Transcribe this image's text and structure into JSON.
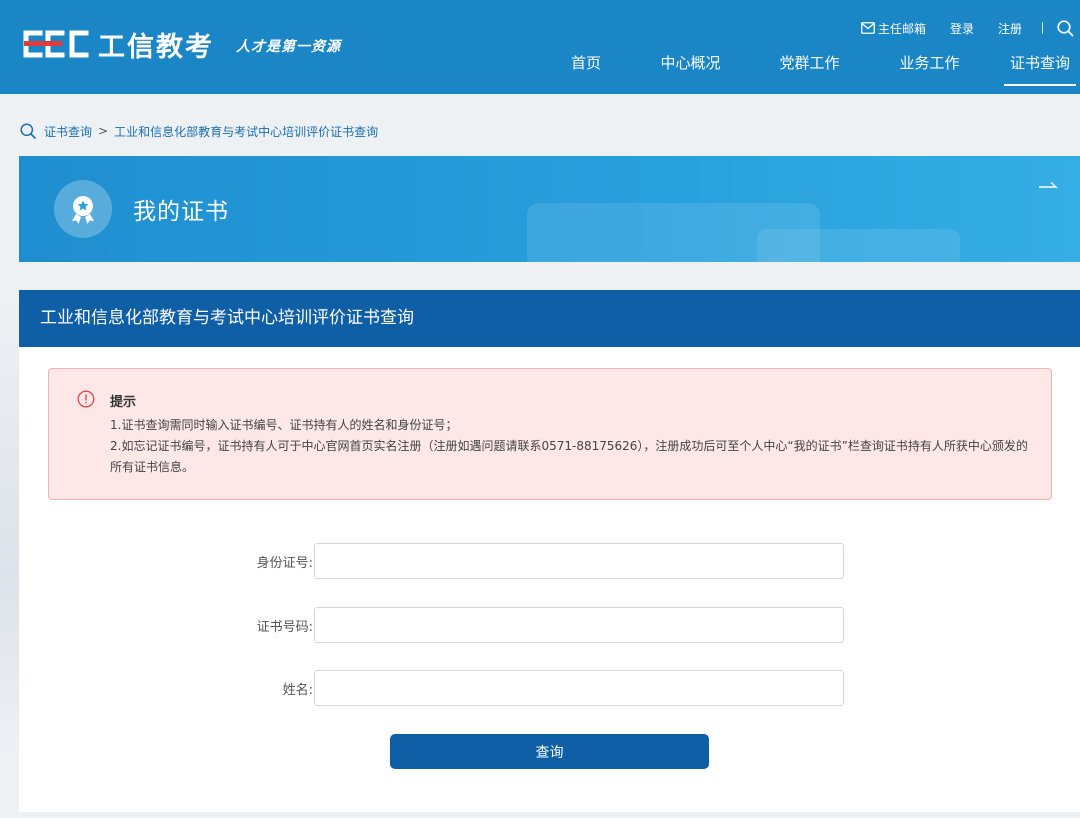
{
  "header": {
    "logo_text": "工信教考",
    "slogan": "人才是第一资源",
    "top_links": {
      "mailbox": "主任邮箱",
      "login": "登录",
      "register": "注册"
    },
    "nav": [
      {
        "label": "首页"
      },
      {
        "label": "中心概况"
      },
      {
        "label": "党群工作"
      },
      {
        "label": "业务工作"
      },
      {
        "label": "证书查询",
        "active": true
      }
    ]
  },
  "breadcrumb": {
    "items": [
      "证书查询",
      "工业和信息化部教育与考试中心培训评价证书查询"
    ],
    "separator": ">"
  },
  "banner": {
    "title": "我的证书"
  },
  "panel": {
    "title": "工业和信息化部教育与考试中心培训评价证书查询",
    "notice": {
      "title": "提示",
      "lines": [
        "1.证书查询需同时输入证书编号、证书持有人的姓名和身份证号；",
        "2.如忘记证书编号，证书持有人可于中心官网首页实名注册（注册如遇问题请联系0571-88175626），注册成功后可至个人中心“我的证书”栏查询证书持有人所获中心颁发的所有证书信息。"
      ]
    },
    "form": {
      "id_label": "身份证号:",
      "id_value": "",
      "cert_label": "证书号码:",
      "cert_value": "",
      "name_label": "姓名:",
      "name_value": "",
      "submit_label": "查询"
    }
  },
  "colors": {
    "header_bg": "#1a86c6",
    "panel_head_bg": "#0f5fa6",
    "notice_bg": "#fde7e7",
    "notice_border": "#f3b2b2",
    "button_bg": "#0f5fa6",
    "link": "#1a6fb0"
  },
  "icons": {
    "mail": "envelope-icon",
    "search": "search-icon",
    "breadcrumb": "search-icon",
    "banner": "award-badge-icon",
    "banner_arrow": "arrow-right-icon",
    "notice": "exclamation-circle-icon"
  }
}
